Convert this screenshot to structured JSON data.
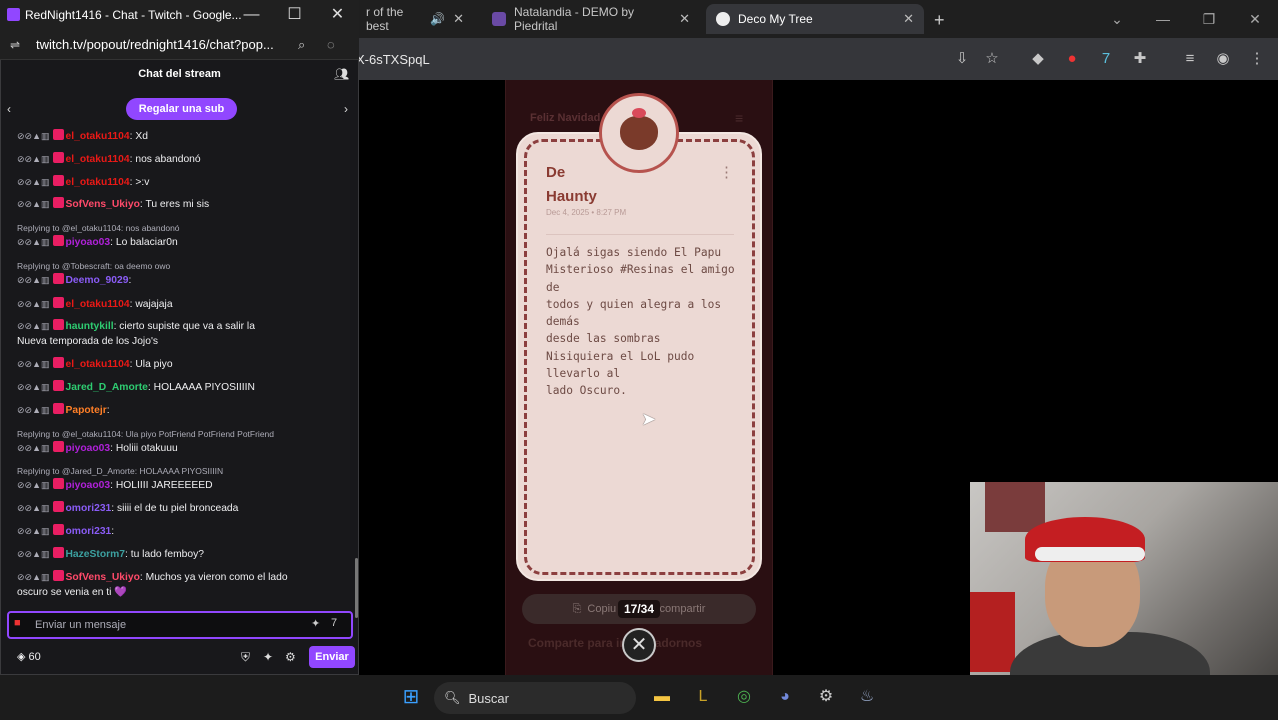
{
  "chrome": {
    "tabs": [
      {
        "label": "r of the best",
        "favicon_color": "#c00"
      },
      {
        "label": "Natalandia - DEMO by Piedrital",
        "favicon_color": "#6a4aa5"
      },
      {
        "label": "Deco My Tree",
        "favicon_color": "#eee"
      }
    ],
    "new_tab": "+",
    "address": "X-6sTXSpqL"
  },
  "chat": {
    "window_title": "RedNight1416 - Chat - Twitch - Google...",
    "url": "twitch.tv/popout/rednight1416/chat?pop...",
    "header": "Chat del stream",
    "gift_button": "Regalar una sub",
    "messages": [
      {
        "type": "msg",
        "user": "el_otaku1104",
        "color": "#e91916",
        "text": ": Xd"
      },
      {
        "type": "msg",
        "user": "el_otaku1104",
        "color": "#e91916",
        "text": ": nos abandonó"
      },
      {
        "type": "msg",
        "user": "el_otaku1104",
        "color": "#e91916",
        "text": ": >:v"
      },
      {
        "type": "msg",
        "user": "SofVens_Ukiyo",
        "color": "#ff4a6a",
        "text": ": Tu eres mi sis"
      },
      {
        "type": "reply",
        "text": "Replying to @el_otaku1104: nos abandonó"
      },
      {
        "type": "msg",
        "user": "piyoao03",
        "color": "#b021d9",
        "text": ": Lo balaciar0n"
      },
      {
        "type": "reply",
        "text": "Replying to @Tobescraft: oa deemo owo"
      },
      {
        "type": "msg",
        "user": "Deemo_9029",
        "color": "#8a5cf6",
        "text": ":"
      },
      {
        "type": "msg",
        "user": "el_otaku1104",
        "color": "#e91916",
        "text": ": wajajaja"
      },
      {
        "type": "msg",
        "user": "hauntykill",
        "color": "#2ecc71",
        "text": ": cierto supiste que va a salir la"
      },
      {
        "type": "cont",
        "text": "Nueva temporada de los Jojo's"
      },
      {
        "type": "msg",
        "user": "el_otaku1104",
        "color": "#e91916",
        "text": ": Ula piyo"
      },
      {
        "type": "msg",
        "user": "Jared_D_Amorte",
        "color": "#2ecc71",
        "text": ": HOLAAAA PIYOSIIIIN"
      },
      {
        "type": "msg",
        "user": "Papotejr",
        "color": "#ff7f27",
        "text": ":"
      },
      {
        "type": "reply",
        "text": "Replying to @el_otaku1104: Ula piyo PotFriend PotFriend PotFriend"
      },
      {
        "type": "msg",
        "user": "piyoao03",
        "color": "#b021d9",
        "text": ": Holiii otakuuu"
      },
      {
        "type": "reply",
        "text": "Replying to @Jared_D_Amorte: HOLAAAA PIYOSIIIIN"
      },
      {
        "type": "msg",
        "user": "piyoao03",
        "color": "#b021d9",
        "text": ": HOLIIII JAREEEEED"
      },
      {
        "type": "msg",
        "user": "omori231",
        "color": "#8a5cf6",
        "text": ": siiii el de tu piel bronceada"
      },
      {
        "type": "msg",
        "user": "omori231",
        "color": "#8a5cf6",
        "text": ":"
      },
      {
        "type": "msg",
        "user": "HazeStorm7",
        "color": "#3ca0a0",
        "text": ": tu lado femboy?"
      },
      {
        "type": "msg",
        "user": "SofVens_Ukiyo",
        "color": "#ff4a6a",
        "text": ": Muchos ya vieron como el lado"
      },
      {
        "type": "cont",
        "text": "oscuro se venia en ti 💜"
      }
    ],
    "input_placeholder": "Enviar un mensaje",
    "points": "60",
    "send_button": "Enviar"
  },
  "tree": {
    "title": "Feliz Navidad",
    "card": {
      "from_label": "De",
      "author": "Haunty",
      "date": "Dec 4, 2025 • 8:27 PM",
      "message": "Ojalá sigas siendo El Papu\nMisterioso #Resinas  el amigo de\ntodos y quien alegra a los demás\ndesde las sombras\nNisiquiera el LoL pudo llevarlo al\nlado Oscuro."
    },
    "copy_button": "Copiu tu e        ara compartir",
    "counter": "17/34",
    "share_text": "Comparte para      ir más adornos"
  },
  "taskbar": {
    "search_label": "Buscar"
  }
}
